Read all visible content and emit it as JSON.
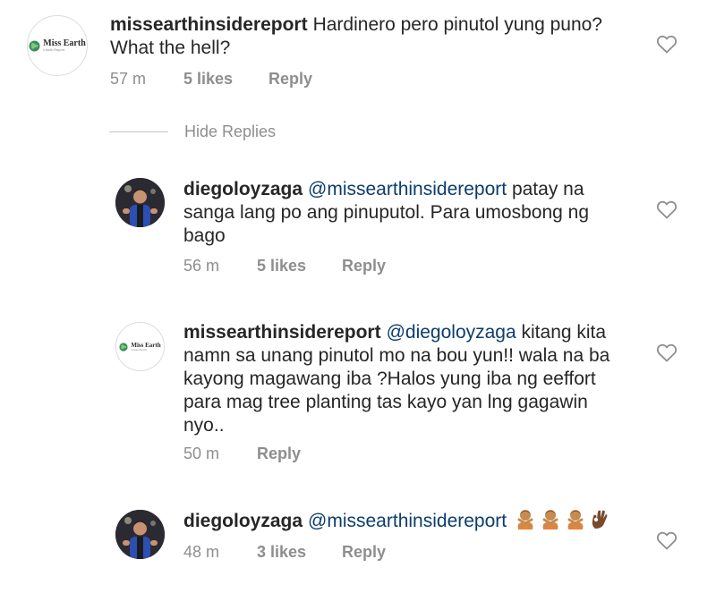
{
  "comments": [
    {
      "username": "missearthinsidereport",
      "mention": "",
      "text": "Hardinero pero pinutol yung puno? What the hell?",
      "time": "57 m",
      "likes": "5 likes",
      "reply": "Reply",
      "avatar": {
        "kind": "brand",
        "logo_title": "Miss Earth",
        "logo_sub": "Inside Report"
      }
    },
    {
      "username": "diegoloyzaga",
      "mention": "@missearthinsidereport",
      "text": "patay na sanga lang po ang pinuputol. Para umosbong ng bago",
      "time": "56 m",
      "likes": "5 likes",
      "reply": "Reply",
      "avatar": {
        "kind": "person"
      }
    },
    {
      "username": "missearthinsidereport",
      "mention": "@diegoloyzaga",
      "text": "kitang kita namn sa unang pinutol mo na bou yun!! wala na ba kayong magawang iba ?Halos yung iba ng eeffort para mag tree planting tas kayo yan lng gagawin nyo..",
      "time": "50 m",
      "likes": "",
      "reply": "Reply",
      "avatar": {
        "kind": "brand",
        "logo_title": "Miss Earth",
        "logo_sub": "Inside Report"
      }
    },
    {
      "username": "diegoloyzaga",
      "mention": "@missearthinsidereport",
      "text": "",
      "emojis": [
        "person-gesturing-no",
        "person-gesturing-no",
        "person-gesturing-no",
        "ok-hand"
      ],
      "time": "48 m",
      "likes": "3 likes",
      "reply": "Reply",
      "avatar": {
        "kind": "person"
      }
    }
  ],
  "thread": {
    "hide_replies": "Hide Replies"
  },
  "icons": {
    "like": "heart-outline-icon"
  },
  "colors": {
    "text": "#262626",
    "meta": "#8e8e8e",
    "mention": "#0b3d6e",
    "heart_stroke": "#8e8e8e"
  }
}
